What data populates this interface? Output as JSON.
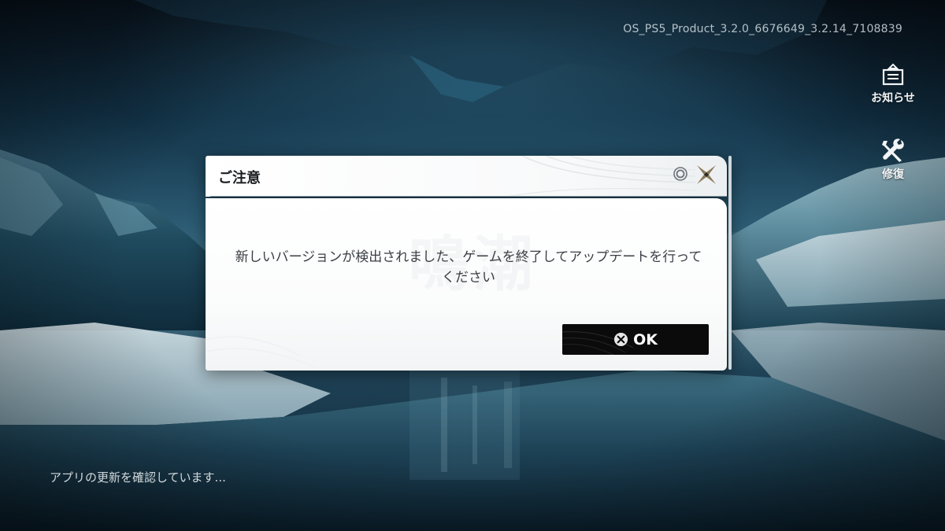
{
  "app": {
    "version_text": "OS_PS5_Product_3.2.0_6676649_3.2.14_7108839"
  },
  "side_menu": {
    "notice_label": "お知らせ",
    "notice_icon": "inbox-tray-icon",
    "repair_label": "修復",
    "repair_icon": "wrench-screwdriver-icon"
  },
  "status": {
    "text": "アプリの更新を確認しています..."
  },
  "dialog": {
    "title": "ご注意",
    "message": "新しいバージョンが検出されました、ゲームを終了してアップデートを行ってください",
    "ok_button": {
      "label": "OK",
      "icon": "ps-cross-button-icon"
    },
    "header_icons": [
      "ps-circle-button-icon",
      "close-x-icon"
    ]
  },
  "colors": {
    "dialog_bg": "#ffffff",
    "button_bg": "#0b0b0b",
    "title_text": "#1c1f22",
    "message_text": "#3a3f44",
    "accent_gold": "#8c7a5b"
  }
}
